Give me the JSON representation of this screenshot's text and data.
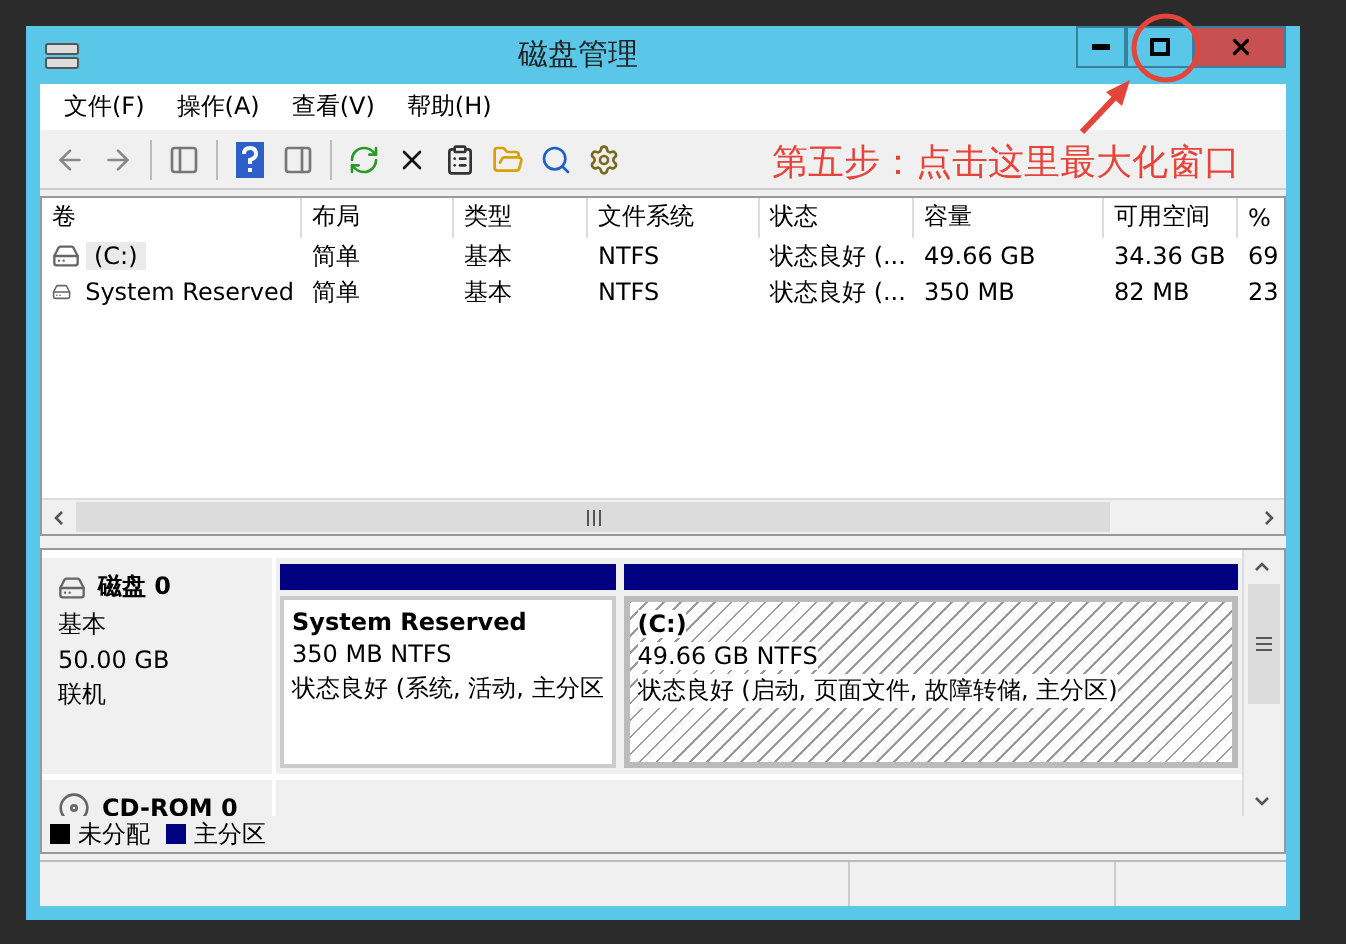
{
  "window": {
    "title": "磁盘管理"
  },
  "menu": [
    "文件(F)",
    "操作(A)",
    "查看(V)",
    "帮助(H)"
  ],
  "annotation": {
    "text": "第五步：点击这里最大化窗口"
  },
  "table": {
    "columns": [
      "卷",
      "布局",
      "类型",
      "文件系统",
      "状态",
      "容量",
      "可用空间",
      "%"
    ],
    "rows": [
      {
        "cells": [
          "(C:)",
          "简单",
          "基本",
          "NTFS",
          "状态良好 (...",
          "49.66 GB",
          "34.36 GB",
          "69"
        ],
        "focused": true
      },
      {
        "cells": [
          "System Reserved",
          "简单",
          "基本",
          "NTFS",
          "状态良好 (...",
          "350 MB",
          "82 MB",
          "23"
        ],
        "focused": false
      }
    ]
  },
  "disks": [
    {
      "kind": "disk",
      "name": "磁盘 0",
      "details": [
        "基本",
        "50.00 GB",
        "联机"
      ],
      "partitions": [
        {
          "name": "System Reserved",
          "size": "350 MB NTFS",
          "status": "状态良好 (系统, 活动, 主分区",
          "color": "#000080",
          "selected": false
        },
        {
          "name": "(C:)",
          "size": "49.66 GB NTFS",
          "status": "状态良好 (启动, 页面文件, 故障转储, 主分区)",
          "color": "#000080",
          "selected": true
        }
      ]
    },
    {
      "kind": "cdrom",
      "name": "CD-ROM 0"
    }
  ],
  "legend": [
    {
      "label": "未分配",
      "color": "#000000"
    },
    {
      "label": "主分区",
      "color": "#000080"
    }
  ]
}
